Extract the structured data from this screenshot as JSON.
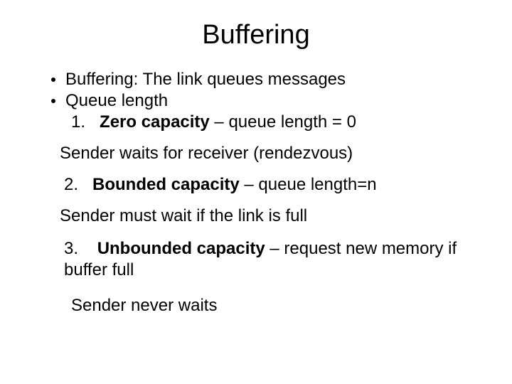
{
  "title": "Buffering",
  "bullets": [
    "Buffering: The link queues messages",
    "Queue length"
  ],
  "item1": {
    "num": "1.",
    "label": "Zero capacity",
    "rest": " – queue length = 0",
    "note": "Sender waits for receiver (rendezvous)"
  },
  "item2": {
    "num": "2.",
    "label": "Bounded capacity",
    "rest": " – queue length=n",
    "note": "Sender must wait if the link is full"
  },
  "item3": {
    "num": "3.",
    "label": "Unbounded capacity",
    "rest": " – request new memory if buffer full",
    "note": "Sender never waits"
  }
}
